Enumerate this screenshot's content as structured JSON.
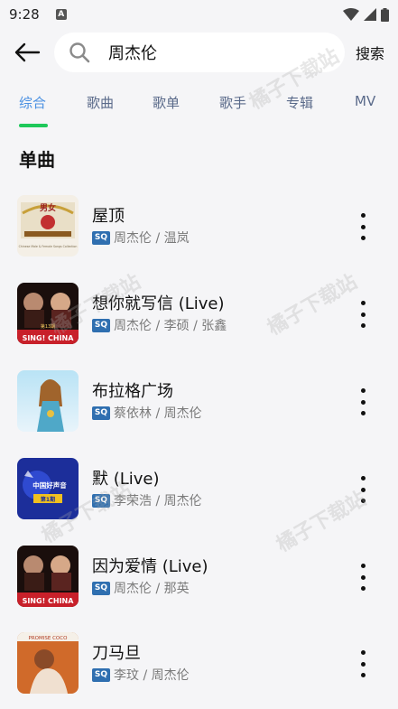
{
  "status": {
    "time": "9:28",
    "a_icon": "A"
  },
  "search": {
    "value": "周杰伦",
    "submit_label": "搜索"
  },
  "tabs": [
    {
      "label": "综合",
      "active": true
    },
    {
      "label": "歌曲",
      "active": false
    },
    {
      "label": "歌单",
      "active": false
    },
    {
      "label": "歌手",
      "active": false
    },
    {
      "label": "专辑",
      "active": false
    },
    {
      "label": "MV",
      "active": false
    }
  ],
  "section": {
    "title": "单曲"
  },
  "quality_badge": "SQ",
  "songs": [
    {
      "title": "屋顶",
      "artists": "周杰伦 / 温岚"
    },
    {
      "title": "想你就写信 (Live)",
      "artists": "周杰伦 / 李硕 / 张鑫"
    },
    {
      "title": "布拉格广场",
      "artists": "蔡依林 / 周杰伦"
    },
    {
      "title": "默 (Live)",
      "artists": "李荣浩 / 周杰伦"
    },
    {
      "title": "因为爱情 (Live)",
      "artists": "周杰伦 / 那英"
    },
    {
      "title": "刀马旦",
      "artists": "李玟 / 周杰伦"
    }
  ],
  "covers": {
    "c1": {
      "top": "男女",
      "sub": "Chinese Male & Female Songs Collection"
    },
    "c2": {
      "text": "SING! CHINA",
      "num": "第13期"
    },
    "c4": {
      "text": "中国好声音",
      "num": "第1期"
    },
    "c5": {
      "text": "SING! CHINA"
    },
    "c6": {
      "text": "PROMISE COCO"
    }
  },
  "watermark": "橘子下载站",
  "colors": {
    "accent": "#4a90e2",
    "indicator": "#1ec85a",
    "badge": "#2f6fb0"
  }
}
